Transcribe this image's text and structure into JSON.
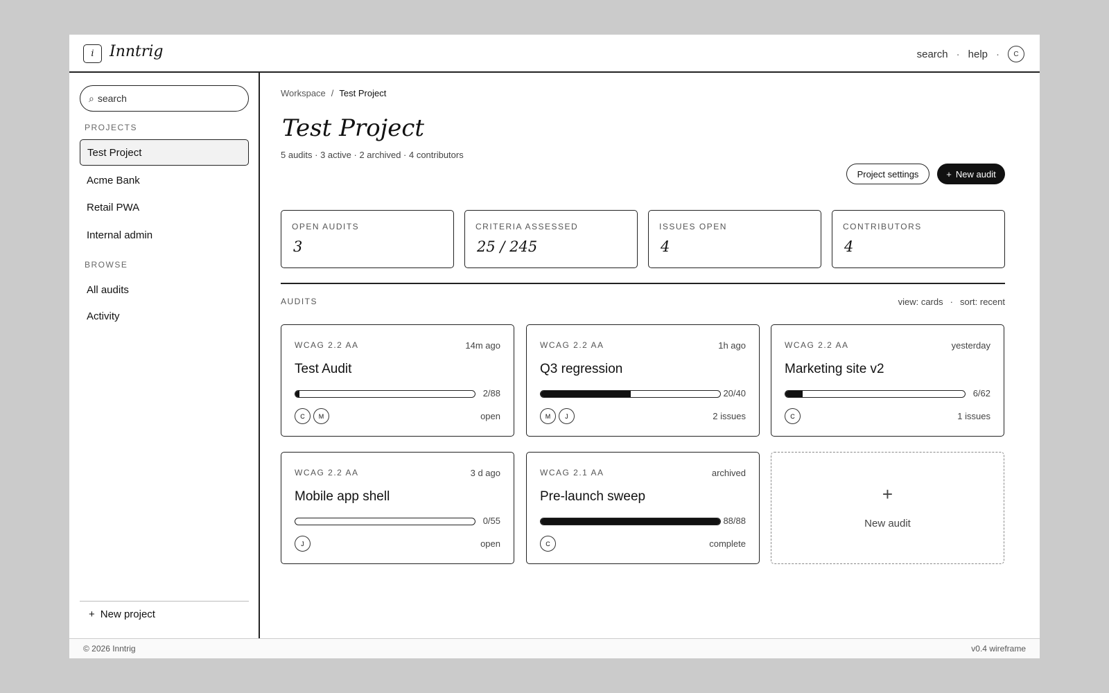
{
  "app": {
    "logo_glyph": "i",
    "name": "Inntrig"
  },
  "topnav": {
    "search": "search",
    "help": "help",
    "separator": "·",
    "user_initial": "C"
  },
  "sidebar": {
    "search_placeholder": "search",
    "search_icon": "⌕",
    "projects_label": "PROJECTS",
    "projects": [
      {
        "label": "Test Project",
        "active": true
      },
      {
        "label": "Acme Bank",
        "active": false
      },
      {
        "label": "Retail PWA",
        "active": false
      },
      {
        "label": "Internal admin",
        "active": false
      }
    ],
    "browse_label": "BROWSE",
    "browse": [
      {
        "label": "All audits"
      },
      {
        "label": "Activity"
      }
    ],
    "new_project_icon": "+",
    "new_project": "New project"
  },
  "breadcrumb": {
    "root": "Workspace",
    "separator": "/",
    "current": "Test Project"
  },
  "page": {
    "title": "Test Project",
    "subtitle": "5 audits · 3 active · 2 archived · 4 contributors",
    "settings_button": "Project settings",
    "new_audit_icon": "+",
    "new_audit_button": "New audit"
  },
  "stats": [
    {
      "label": "OPEN AUDITS",
      "value": "3"
    },
    {
      "label": "CRITERIA ASSESSED",
      "value": "25 / 245"
    },
    {
      "label": "ISSUES OPEN",
      "value": "4"
    },
    {
      "label": "CONTRIBUTORS",
      "value": "4"
    }
  ],
  "audits_section": {
    "label": "AUDITS",
    "view": "view: cards",
    "separator": "·",
    "sort": "sort: recent"
  },
  "audits": [
    {
      "standard": "WCAG 2.2 AA",
      "time": "14m ago",
      "name": "Test Audit",
      "count": "2/88",
      "progress": 0.023,
      "avatars": [
        "C",
        "M"
      ],
      "status": "open"
    },
    {
      "standard": "WCAG 2.2 AA",
      "time": "1h ago",
      "name": "Q3 regression",
      "count": "20/40",
      "progress": 0.5,
      "avatars": [
        "M",
        "J"
      ],
      "status": "2 issues"
    },
    {
      "standard": "WCAG 2.2 AA",
      "time": "yesterday",
      "name": "Marketing site v2",
      "count": "6/62",
      "progress": 0.097,
      "avatars": [
        "C"
      ],
      "status": "1 issues"
    },
    {
      "standard": "WCAG 2.2 AA",
      "time": "3 d ago",
      "name": "Mobile app shell",
      "count": "0/55",
      "progress": 0,
      "avatars": [
        "J"
      ],
      "status": "open"
    },
    {
      "standard": "WCAG 2.1 AA",
      "time": "archived",
      "name": "Pre-launch sweep",
      "count": "88/88",
      "progress": 1,
      "avatars": [
        "C"
      ],
      "status": "complete"
    }
  ],
  "new_audit_card": {
    "icon": "+",
    "label": "New audit"
  },
  "footer": {
    "copyright": "© 2026 Inntrig",
    "version": "v0.4 wireframe"
  }
}
